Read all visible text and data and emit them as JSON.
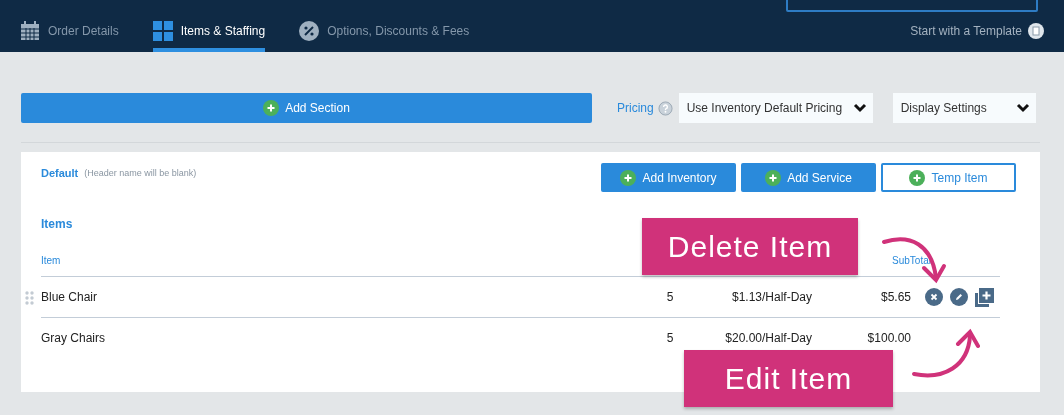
{
  "tabs": [
    {
      "label": "Order Details",
      "kind": "calendar",
      "selected": false
    },
    {
      "label": "Items & Staffing",
      "kind": "grid",
      "selected": true
    },
    {
      "label": "Options, Discounts & Fees",
      "kind": "percent",
      "selected": false
    }
  ],
  "template_link": "Start with a Template",
  "add_section": "Add Section",
  "pricing": {
    "label": "Pricing",
    "value": "Use Inventory Default Pricing"
  },
  "display_settings": "Display Settings",
  "section": {
    "name": "Default",
    "note": "(Header name will be blank)",
    "buttons": [
      {
        "label": "Add Inventory",
        "kind": "filled"
      },
      {
        "label": "Add Service",
        "kind": "filled"
      },
      {
        "label": "Temp Item",
        "kind": "outline"
      }
    ],
    "title": "Items",
    "columns": {
      "item": "Item",
      "subtotal": "SubTotal"
    },
    "rows": [
      {
        "item": "Blue Chair",
        "qty": "5",
        "price": "$1.13/Half-Day",
        "subtotal": "$5.65",
        "hovered": true
      },
      {
        "item": "Gray Chairs",
        "qty": "5",
        "price": "$20.00/Half-Day",
        "subtotal": "$100.00",
        "hovered": false
      }
    ]
  },
  "callouts": [
    {
      "text": "Delete Item",
      "kind": "top"
    },
    {
      "text": "Edit Item",
      "kind": "bottom"
    }
  ]
}
